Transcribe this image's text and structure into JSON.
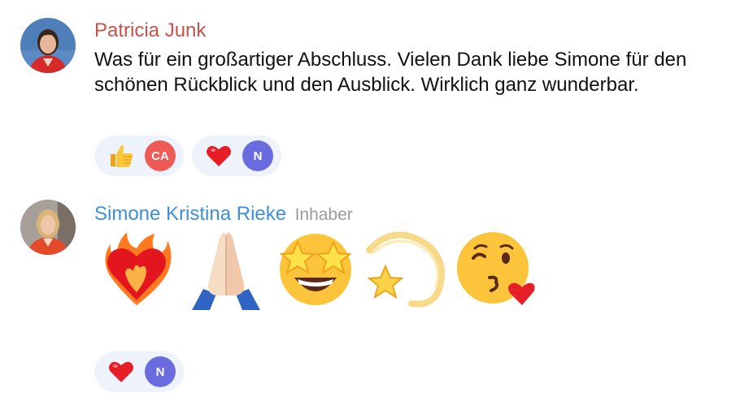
{
  "comments": [
    {
      "author": "Patricia Junk",
      "author_color": "#c9514b",
      "text": "Was für ein großartiger Abschluss. Vielen Dank liebe Simone für den schönen Rückblick und den Ausblick. Wirklich ganz wunderbar.",
      "reactions": [
        {
          "emoji": "thumbs-up-icon",
          "user_initials": "CA",
          "user_color": "#ee5a55"
        },
        {
          "emoji": "heart-icon",
          "user_initials": "N",
          "user_color": "#6b6be0"
        }
      ]
    },
    {
      "author": "Simone Kristina Rieke",
      "author_color": "#3f8fd6",
      "role": "Inhaber",
      "emojis": [
        "heart-on-fire-icon",
        "folded-hands-icon",
        "star-struck-icon",
        "dizzy-star-icon",
        "face-blowing-kiss-icon"
      ],
      "reactions": [
        {
          "emoji": "heart-icon",
          "user_initials": "N",
          "user_color": "#6b6be0"
        }
      ]
    }
  ]
}
